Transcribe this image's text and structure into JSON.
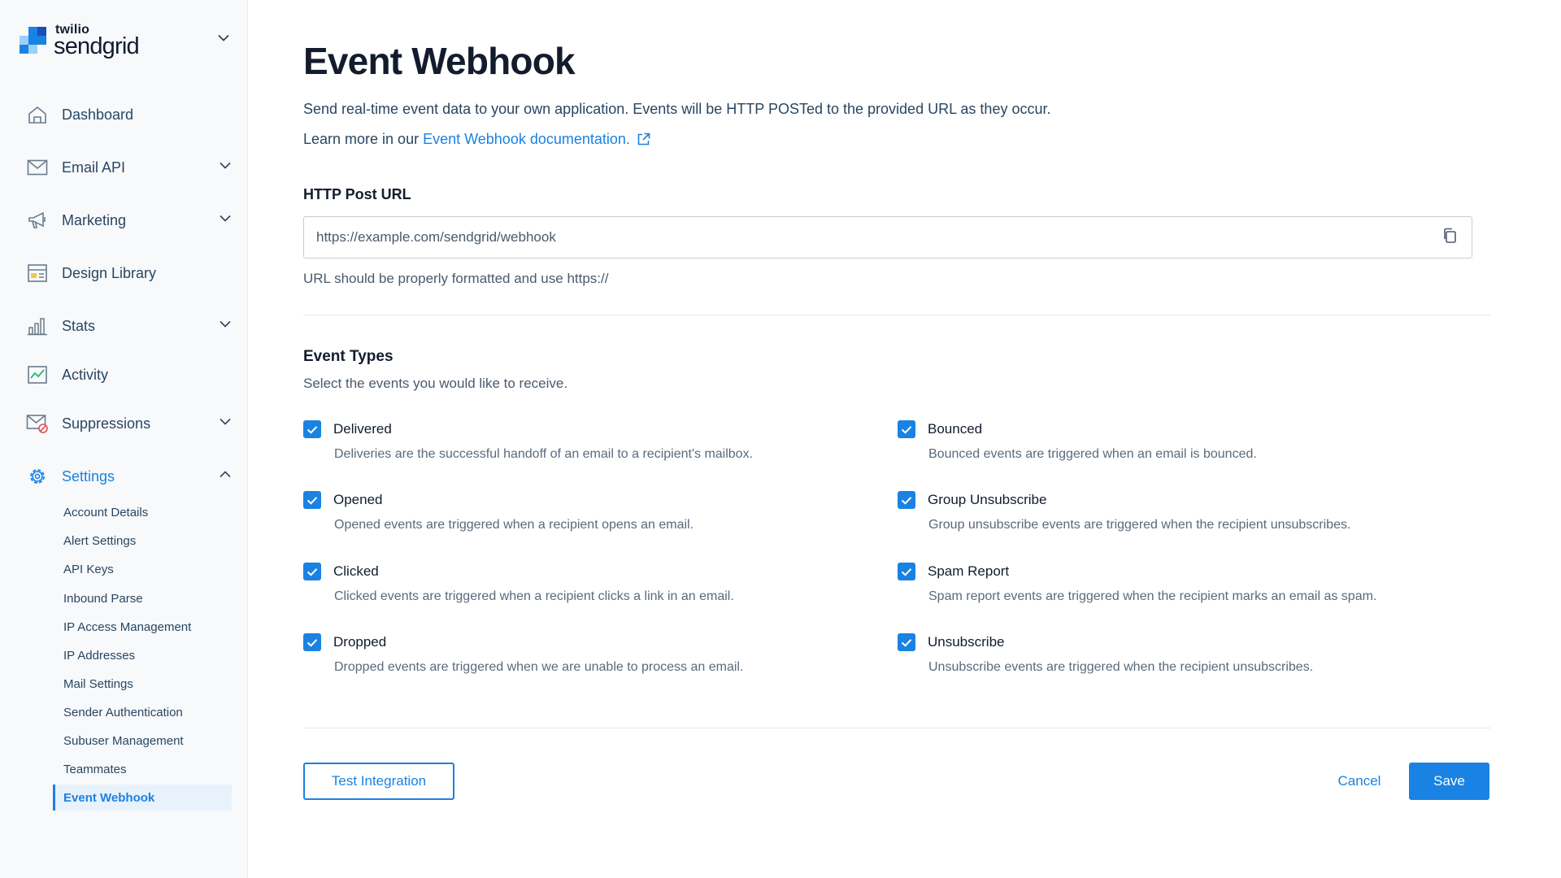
{
  "brand": {
    "small": "twilio",
    "big": "sendgrid"
  },
  "colors": {
    "accent": "#1a82e2",
    "text": "#294661",
    "heading": "#121c2d",
    "logo_dark": "#1a4fb8",
    "logo_mid": "#1a82e2",
    "logo_light": "#99d0f7"
  },
  "sidebar": {
    "items": [
      {
        "label": "Dashboard",
        "icon": "home-icon"
      },
      {
        "label": "Email API",
        "icon": "envelope-icon",
        "expandable": true
      },
      {
        "label": "Marketing",
        "icon": "megaphone-icon",
        "expandable": true
      },
      {
        "label": "Design Library",
        "icon": "layout-icon"
      },
      {
        "label": "Stats",
        "icon": "bar-chart-icon",
        "expandable": true
      },
      {
        "label": "Activity",
        "icon": "activity-icon"
      },
      {
        "label": "Suppressions",
        "icon": "envelope-blocked-icon",
        "expandable": true
      },
      {
        "label": "Settings",
        "icon": "gear-icon",
        "expandable": true,
        "expanded": true,
        "active": true
      }
    ],
    "settings_items": [
      {
        "label": "Account Details"
      },
      {
        "label": "Alert Settings"
      },
      {
        "label": "API Keys"
      },
      {
        "label": "Inbound Parse"
      },
      {
        "label": "IP Access Management"
      },
      {
        "label": "IP Addresses"
      },
      {
        "label": "Mail Settings"
      },
      {
        "label": "Sender Authentication"
      },
      {
        "label": "Subuser Management"
      },
      {
        "label": "Teammates"
      },
      {
        "label": "Event Webhook",
        "active": true
      }
    ]
  },
  "main": {
    "title": "Event Webhook",
    "description": "Send real-time event data to your own application. Events will be HTTP POSTed to the provided URL as they occur.",
    "learn_prefix": "Learn more in our",
    "learn_link": "Event Webhook documentation.",
    "url_label": "HTTP Post URL",
    "url_value": "https://example.com/sendgrid/webhook",
    "url_helper": "URL should be properly formatted and use https://",
    "event_types_title": "Event Types",
    "event_types_sub": "Select the events you would like to receive.",
    "events": [
      {
        "name": "Delivered",
        "desc": "Deliveries are the successful handoff of an email to a recipient's mailbox.",
        "checked": true
      },
      {
        "name": "Bounced",
        "desc": "Bounced events are triggered when an email is bounced.",
        "checked": true
      },
      {
        "name": "Opened",
        "desc": "Opened events are triggered when a recipient opens an email.",
        "checked": true
      },
      {
        "name": "Group Unsubscribe",
        "desc": "Group unsubscribe events are triggered when the recipient unsubscribes.",
        "checked": true
      },
      {
        "name": "Clicked",
        "desc": "Clicked events are triggered when a recipient clicks a link in an email.",
        "checked": true
      },
      {
        "name": "Spam Report",
        "desc": "Spam report events are triggered when the recipient marks an email as spam.",
        "checked": true
      },
      {
        "name": "Dropped",
        "desc": "Dropped events are triggered when we are unable to process an email.",
        "checked": true
      },
      {
        "name": "Unsubscribe",
        "desc": "Unsubscribe events are triggered when the recipient unsubscribes.",
        "checked": true
      }
    ]
  },
  "buttons": {
    "test": "Test Integration",
    "cancel": "Cancel",
    "save": "Save"
  }
}
